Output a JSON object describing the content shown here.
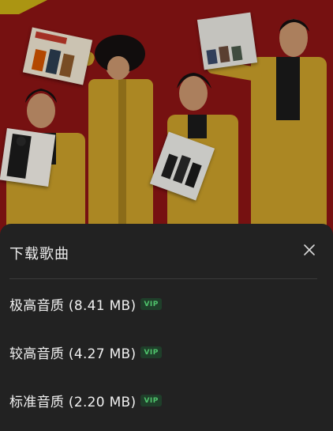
{
  "sheet": {
    "title": "下载歌曲",
    "close_icon": "close-icon",
    "options": [
      {
        "label": "极高音质 (8.41 MB)",
        "badge": "VIP"
      },
      {
        "label": "较高音质 (4.27 MB)",
        "badge": "VIP"
      },
      {
        "label": "标准音质 (2.20 MB)",
        "badge": "VIP"
      }
    ]
  },
  "colors": {
    "sheet_background": "#222222",
    "cover_background": "#8b1414",
    "vip_text": "#4fc46c",
    "vip_background": "#1f3f2a",
    "suit": "#c99f2a"
  }
}
